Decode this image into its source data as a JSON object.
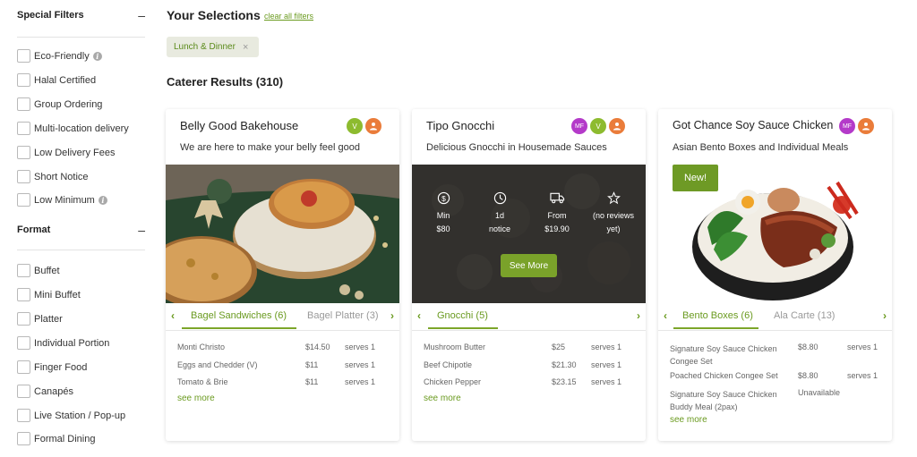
{
  "sidebar": {
    "special_filters": {
      "title": "Special Filters",
      "collapse": "–",
      "items": [
        {
          "label": "Eco-Friendly",
          "info": true
        },
        {
          "label": "Halal Certified",
          "info": false
        },
        {
          "label": "Group Ordering",
          "info": false
        },
        {
          "label": "Multi-location delivery",
          "info": false
        },
        {
          "label": "Low Delivery Fees",
          "info": false
        },
        {
          "label": "Short Notice",
          "info": false
        },
        {
          "label": "Low Minimum",
          "info": true
        }
      ]
    },
    "format": {
      "title": "Format",
      "collapse": "–",
      "items": [
        {
          "label": "Buffet"
        },
        {
          "label": "Mini Buffet"
        },
        {
          "label": "Platter"
        },
        {
          "label": "Individual Portion"
        },
        {
          "label": "Finger Food"
        },
        {
          "label": "Canapés"
        },
        {
          "label": "Live Station / Pop-up"
        },
        {
          "label": "Formal Dining"
        }
      ]
    }
  },
  "selections": {
    "title": "Your Selections",
    "clear_all": "clear all filters",
    "chip": "Lunch & Dinner",
    "chip_remove": "×"
  },
  "results": {
    "title": "Caterer Results (310)"
  },
  "info_glyph": "i",
  "arrows": {
    "prev": "‹",
    "next": "›"
  },
  "colors": {
    "accent": "#7aa22a",
    "vegetarian": "#8dbb2f",
    "muslim_friendly": "#b43ac9",
    "group": "#ea7c3a"
  },
  "cards": [
    {
      "name": "Belly Good Bakehouse",
      "description": "We are here to make your belly feel good",
      "badges": [
        "V",
        "group-icon"
      ],
      "tabs": [
        "Bagel Sandwiches (6)",
        "Bagel Platter (3)"
      ],
      "items": [
        {
          "name": "Monti Christo",
          "price": "$14.50",
          "serves": "serves 1"
        },
        {
          "name": "Eggs and Chedder (V)",
          "price": "$11",
          "serves": "serves 1"
        },
        {
          "name": "Tomato & Brie",
          "price": "$11",
          "serves": "serves 1"
        }
      ],
      "see_more": "see more"
    },
    {
      "name": "Tipo Gnocchi",
      "description": "Delicious Gnocchi in Housemade Sauces",
      "badges": [
        "MF",
        "V",
        "group-icon"
      ],
      "stats": [
        {
          "icon": "dollar-icon",
          "line1": "Min",
          "line2": "$80"
        },
        {
          "icon": "clock-icon",
          "line1": "1d",
          "line2": "notice"
        },
        {
          "icon": "truck-icon",
          "line1": "From",
          "line2": "$19.90"
        },
        {
          "icon": "star-icon",
          "line1": "(no reviews",
          "line2": "yet)"
        }
      ],
      "overlay_button": "See More",
      "tabs": [
        "Gnocchi (5)"
      ],
      "items": [
        {
          "name": "Mushroom Butter",
          "price": "$25",
          "serves": "serves 1"
        },
        {
          "name": "Beef Chipotle",
          "price": "$21.30",
          "serves": "serves 1"
        },
        {
          "name": "Chicken Pepper",
          "price": "$23.15",
          "serves": "serves 1"
        }
      ],
      "see_more": "see more"
    },
    {
      "name": "Got Chance Soy Sauce Chicken",
      "description": "Asian Bento Boxes and Individual Meals",
      "badges": [
        "MF",
        "group-icon"
      ],
      "new_tag": "New!",
      "tabs": [
        "Bento Boxes (6)",
        "Ala Carte (13)"
      ],
      "items": [
        {
          "name_l1": "Signature Soy Sauce Chicken",
          "name_l2": "Congee Set",
          "price": "$8.80",
          "serves": "serves 1"
        },
        {
          "name_l1": "Poached Chicken Congee Set",
          "name_l2": "",
          "price": "$8.80",
          "serves": "serves 1"
        },
        {
          "name_l1": "Signature Soy Sauce Chicken",
          "name_l2": "Buddy Meal (2pax)",
          "price": "Unavailable",
          "serves": ""
        }
      ],
      "see_more": "see more"
    }
  ]
}
